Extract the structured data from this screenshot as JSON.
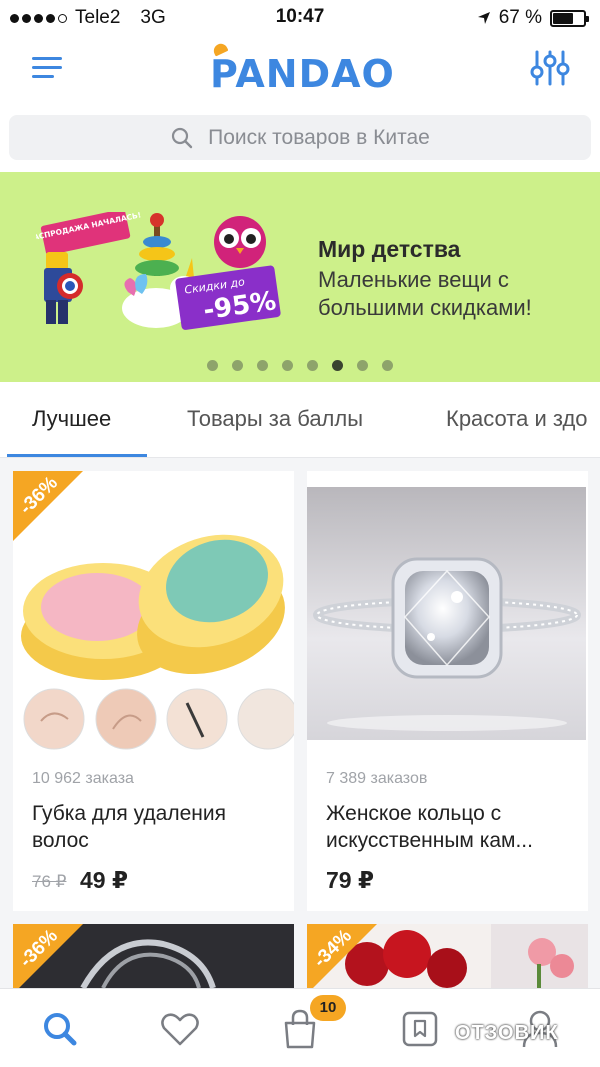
{
  "status_bar": {
    "carrier": "Tele2",
    "network": "3G",
    "time": "10:47",
    "battery": "67 %",
    "battery_level": 0.67
  },
  "header": {
    "logo_text": "PANDAO",
    "menu_icon": "hamburger-menu-icon",
    "filter_icon": "sliders-filter-icon"
  },
  "search": {
    "placeholder": "Поиск товаров в Китае",
    "icon": "search-icon"
  },
  "banner": {
    "title": "Мир детства",
    "subtitle": "Маленькие вещи с большими скидками!",
    "art_sale_label": "РАСПРОДАЖА НАЧАЛАСЬ!",
    "art_discount_label": "Скидки до",
    "art_discount_value": "-95%",
    "page_count": 8,
    "active_page": 6
  },
  "tabs": [
    {
      "label": "Лучшее",
      "active": true
    },
    {
      "label": "Товары за баллы",
      "active": false
    },
    {
      "label": "Красота и здо",
      "active": false
    }
  ],
  "products": [
    {
      "discount": "-36%",
      "orders": "10 962 заказа",
      "title": "Губка для удаления волос",
      "old_price": "76 ₽",
      "price": "49 ₽"
    },
    {
      "discount": "",
      "orders": "7 389 заказов",
      "title": "Женское кольцо с искусственным кам...",
      "old_price": "",
      "price": "79 ₽"
    },
    {
      "discount": "-36%"
    },
    {
      "discount": "-34%"
    }
  ],
  "bottom_nav": {
    "items": [
      "search-icon",
      "heart-icon",
      "shopping-bag-icon",
      "bookmark-icon",
      "profile-icon"
    ],
    "cart_count": "10",
    "active": "search-icon"
  },
  "watermark": "ОТЗОВИК",
  "colors": {
    "accent": "#3d87e0",
    "badge": "#f5a623",
    "banner_bg": "#cdf08a"
  }
}
